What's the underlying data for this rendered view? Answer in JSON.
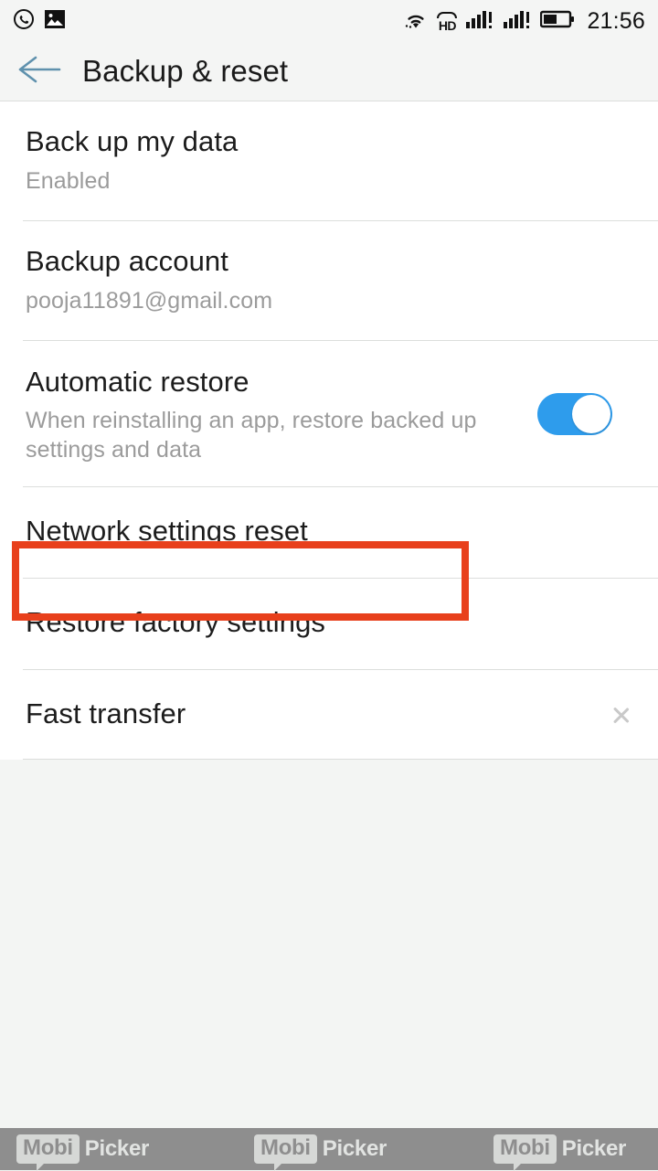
{
  "status_bar": {
    "left_icons": [
      "whatsapp-icon",
      "photo-icon"
    ],
    "right_icons": [
      "wifi-icon",
      "hd-volte-icon",
      "signal-sim1-icon",
      "signal-sim2-icon",
      "battery-icon"
    ],
    "hd_label": "HD",
    "time": "21:56",
    "battery_percent": 50
  },
  "app_bar": {
    "back_icon": "back-arrow-icon",
    "title": "Backup & reset",
    "back_arrow_color": "#5f91ad"
  },
  "list": {
    "rows": [
      {
        "name": "back-up-my-data",
        "title": "Back up my data",
        "subtitle": "Enabled",
        "control": "none"
      },
      {
        "name": "backup-account",
        "title": "Backup account",
        "subtitle": "pooja11891@gmail.com",
        "control": "none"
      },
      {
        "name": "automatic-restore",
        "title": "Automatic restore",
        "subtitle": "When reinstalling an app, restore backed up settings and data",
        "control": "toggle",
        "toggle_state": "on"
      },
      {
        "name": "network-settings-reset",
        "title": "Network settings reset",
        "subtitle": "",
        "control": "none"
      },
      {
        "name": "restore-factory-settings",
        "title": "Restore factory settings",
        "subtitle": "",
        "control": "none",
        "highlighted": true
      },
      {
        "name": "fast-transfer",
        "title": "Fast transfer",
        "subtitle": "",
        "control": "chevron"
      }
    ]
  },
  "annotation": {
    "target": "Restore factory settings",
    "color": "#e8401c"
  },
  "footer": {
    "watermarks": [
      {
        "badge": "Mobi",
        "text": "Picker"
      },
      {
        "badge": "Mobi",
        "text": "Picker"
      },
      {
        "badge": "Mobi",
        "text": "Picker"
      }
    ]
  },
  "colors": {
    "accent_toggle": "#2e9cec",
    "annotation": "#e8401c",
    "page_background": "#f3f5f3",
    "list_background": "#ffffff"
  }
}
